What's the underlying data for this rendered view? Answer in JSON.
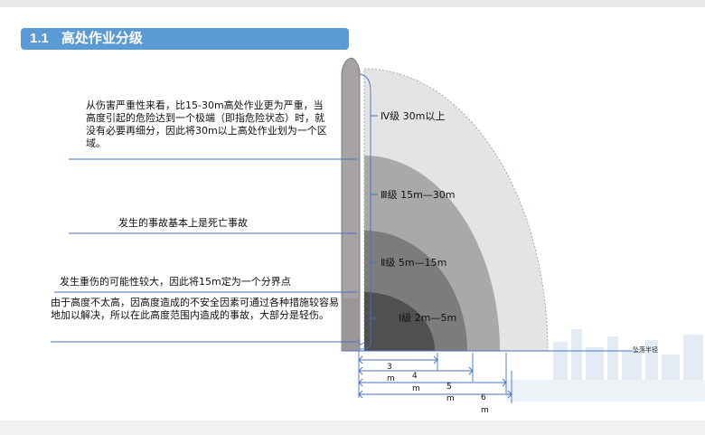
{
  "header": {
    "section_number": "1.1",
    "section_title": "高处作业分级"
  },
  "levels": [
    {
      "label": "Ⅳ级  30m以上",
      "color": "#e4e4e4"
    },
    {
      "label": "Ⅲ级  15m—30m",
      "color": "#a9a9a9"
    },
    {
      "label": "Ⅱ级  5m—15m",
      "color": "#7c7c7c"
    },
    {
      "label": "Ⅰ级  2m—5m",
      "color": "#505050"
    }
  ],
  "notes": [
    "从伤害严重性来看，比15-30m高处作业更为严重，当高度引起的危险达到一个极端（即指危险状态）时，就没有必要再细分，因此将30m以上高处作业划为一个区域。",
    "发生的事故基本上是死亡事故",
    "发生重伤的可能性较大，因此将15m定为一个分界点",
    "由于高度不太高，因高度造成的不安全因素可通过各种措施较容易地加以解决，所以在此高度范围内造成的事故，大部分是轻伤。"
  ],
  "radius_label": "坠落半径",
  "radius_dims": [
    {
      "value": "3",
      "unit": "m"
    },
    {
      "value": "4",
      "unit": "m"
    },
    {
      "value": "5",
      "unit": "m"
    },
    {
      "value": "6",
      "unit": "m"
    }
  ],
  "accent_color": "#4472c4"
}
